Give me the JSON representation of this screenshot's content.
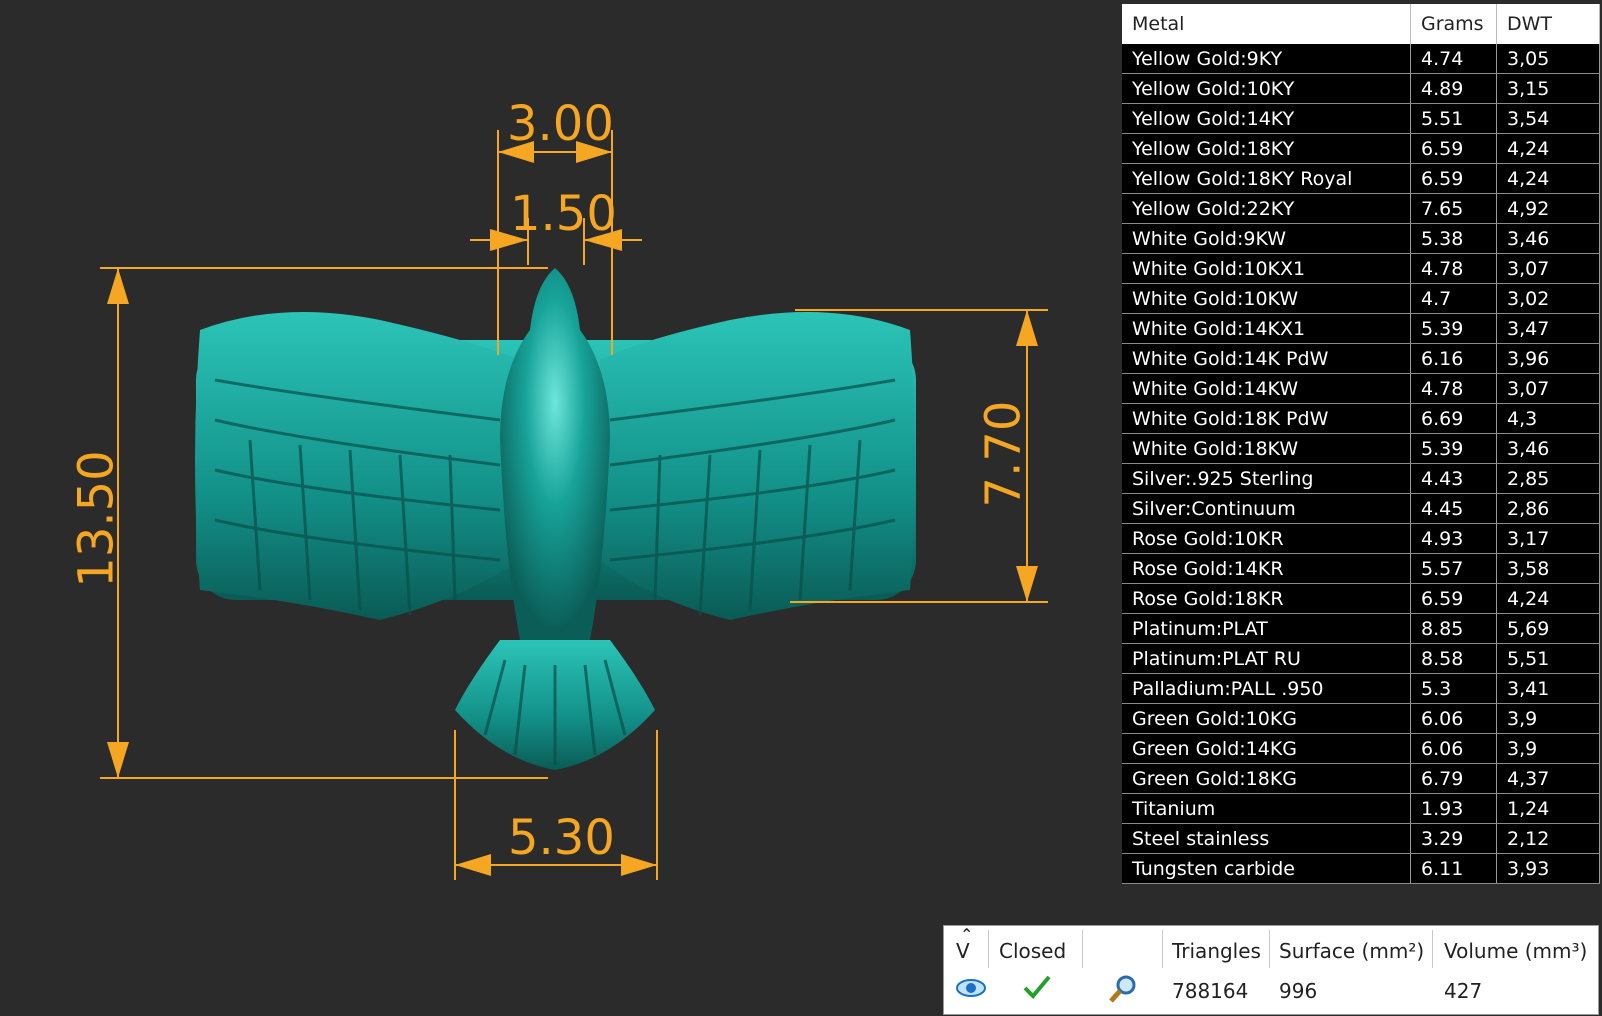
{
  "dimensions": {
    "d1": "3.00",
    "d2": "1.50",
    "d3": "13.50",
    "d4": "7.70",
    "d5": "5.30"
  },
  "colors": {
    "accent": "#f5a623",
    "model": "#1aa39a",
    "background": "#2b2b2b"
  },
  "table": {
    "headers": [
      "Metal",
      "Grams",
      "DWT"
    ],
    "rows": [
      [
        "Yellow Gold:9KY",
        "4.74",
        "3,05"
      ],
      [
        "Yellow Gold:10KY",
        "4.89",
        "3,15"
      ],
      [
        "Yellow Gold:14KY",
        "5.51",
        "3,54"
      ],
      [
        "Yellow Gold:18KY",
        "6.59",
        "4,24"
      ],
      [
        "Yellow Gold:18KY Royal",
        "6.59",
        "4,24"
      ],
      [
        "Yellow Gold:22KY",
        "7.65",
        "4,92"
      ],
      [
        "White Gold:9KW",
        "5.38",
        "3,46"
      ],
      [
        "White Gold:10KX1",
        "4.78",
        "3,07"
      ],
      [
        "White Gold:10KW",
        "4.7",
        "3,02"
      ],
      [
        "White Gold:14KX1",
        "5.39",
        "3,47"
      ],
      [
        "White Gold:14K PdW",
        "6.16",
        "3,96"
      ],
      [
        "White Gold:14KW",
        "4.78",
        "3,07"
      ],
      [
        "White Gold:18K PdW",
        "6.69",
        "4,3"
      ],
      [
        "White Gold:18KW",
        "5.39",
        "3,46"
      ],
      [
        "Silver:.925 Sterling",
        "4.43",
        "2,85"
      ],
      [
        "Silver:Continuum",
        "4.45",
        "2,86"
      ],
      [
        "Rose Gold:10KR",
        "4.93",
        "3,17"
      ],
      [
        "Rose Gold:14KR",
        "5.57",
        "3,58"
      ],
      [
        "Rose Gold:18KR",
        "6.59",
        "4,24"
      ],
      [
        "Platinum:PLAT",
        "8.85",
        "5,69"
      ],
      [
        "Platinum:PLAT RU",
        "8.58",
        "5,51"
      ],
      [
        "Palladium:PALL .950",
        "5.3",
        "3,41"
      ],
      [
        "Green Gold:10KG",
        "6.06",
        "3,9"
      ],
      [
        "Green Gold:14KG",
        "6.06",
        "3,9"
      ],
      [
        "Green Gold:18KG",
        "6.79",
        "4,37"
      ],
      [
        "Titanium",
        "1.93",
        "1,24"
      ],
      [
        "Steel stainless",
        "3.29",
        "2,12"
      ],
      [
        "Tungsten carbide",
        "6.11",
        "3,93"
      ]
    ]
  },
  "mesh": {
    "v_header": "V",
    "closed_header": "Closed",
    "triangles_header": "Triangles",
    "surface_header": "Surface (mm²)",
    "volume_header": "Volume (mm³)",
    "triangles": "788164",
    "surface": "996",
    "volume": "427",
    "icons": [
      "eye-icon",
      "checkmark-icon",
      "magnifier-icon"
    ]
  }
}
